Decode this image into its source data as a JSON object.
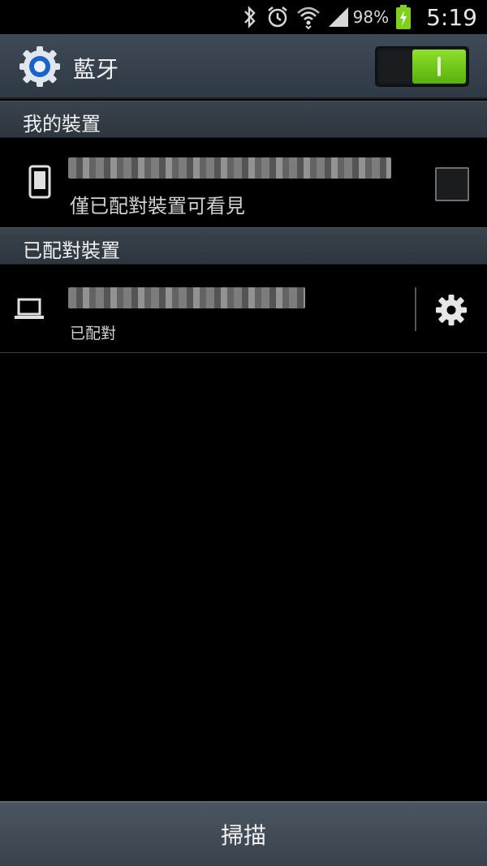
{
  "status_bar": {
    "battery_percent": "98%",
    "time": "5:19",
    "icons": [
      "bluetooth-icon",
      "alarm-icon",
      "wifi-icon",
      "signal-icon",
      "battery-charging-icon"
    ]
  },
  "app_bar": {
    "title": "藍牙",
    "icon": "bluetooth-settings-gear-icon",
    "toggle_on": true,
    "toggle_color": "#6cc91a"
  },
  "sections": {
    "my_device": {
      "header": "我的裝置",
      "device_visibility": "僅已配對裝置可看見"
    },
    "paired_devices": {
      "header": "已配對裝置",
      "device_status": "已配對"
    }
  },
  "bottom_bar": {
    "scan_label": "掃描"
  }
}
